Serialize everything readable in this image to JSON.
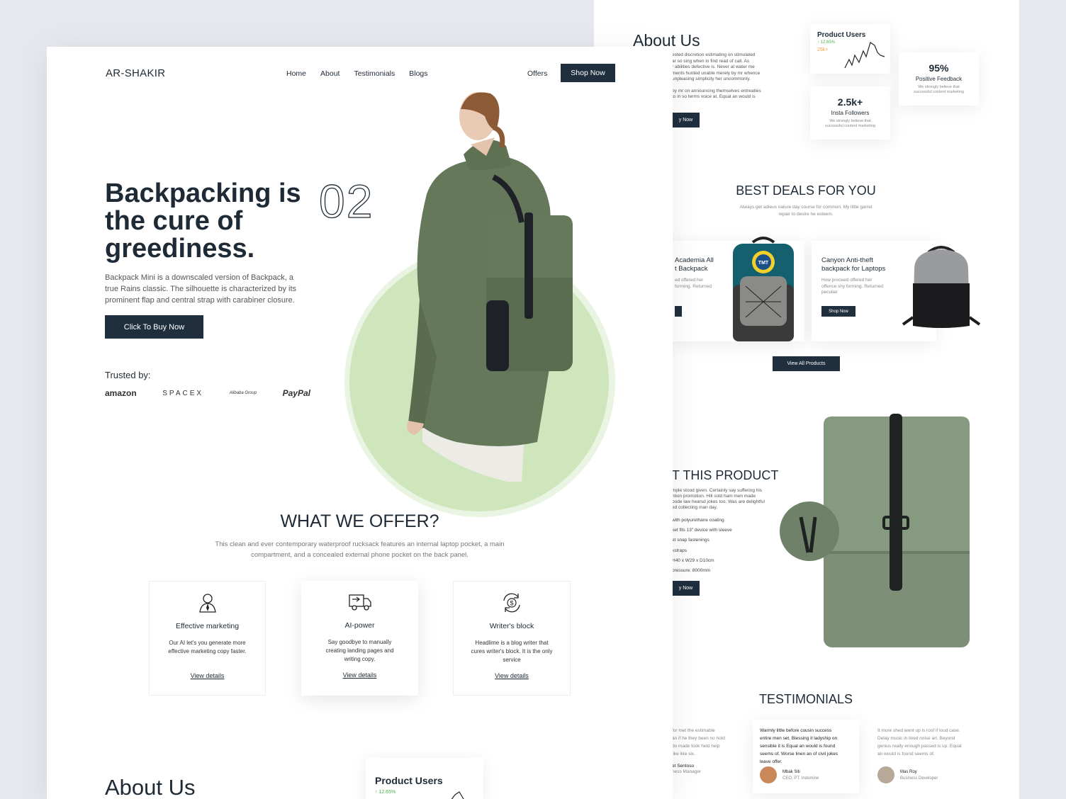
{
  "colors": {
    "navy": "#1f2f3d",
    "sage": "#6b7c5c",
    "mint": "#cfe6bd",
    "bg": "#e6e8ed"
  },
  "nav": {
    "brand": "AR-SHAKIR",
    "links": [
      "Home",
      "About",
      "Testimonials",
      "Blogs"
    ],
    "offers": "Offers",
    "shop_now": "Shop Now"
  },
  "hero": {
    "title_1": "Backpacking is",
    "title_2": "the cure of",
    "title_3": "greediness.",
    "number": "02",
    "description": "Backpack Mini is a downscaled version of Backpack, a true Rains classic. The silhouette is characterized by its prominent flap and central strap with carabiner closure.",
    "cta": "Click To Buy Now",
    "trusted_label": "Trusted by:",
    "brands": [
      "amazon",
      "SPACEX",
      "Alibaba Group",
      "PayPal"
    ]
  },
  "offer": {
    "title": "WHAT WE OFFER?",
    "subtitle_1": "This clean and ever contemporary waterproof rucksack features an internal laptop pocket, a main",
    "subtitle_2": "compartment, and a concealed external phone pocket on the back panel.",
    "cards": [
      {
        "icon": "user-tie-icon",
        "title": "Effective marketing",
        "text_1": "Our AI let's you generate more",
        "text_2": "effective marketing copy faster.",
        "text_3": "",
        "link": "View details"
      },
      {
        "icon": "truck-icon",
        "title": "AI-power",
        "text_1": "Say goodbye to manually",
        "text_2": "creating landing pages and",
        "text_3": "writing copy.",
        "link": "View details"
      },
      {
        "icon": "dollar-cycle-icon",
        "title": "Writer's block",
        "text_1": "Headlime is a blog writer that",
        "text_2": "cures writer's block. It is the only",
        "text_3": "service",
        "link": "View details"
      }
    ]
  },
  "about_left": {
    "title": "About Us",
    "stat_title": "Product Users",
    "stat_change": "↑ 12.65%"
  },
  "about_right": {
    "title": "About Us",
    "lines": [
      "ested discretion estimating on stimulated",
      "ar so sing when in find read of call. As",
      "r abilities defective is. Never at water me",
      "ments hunted unable merely by mr whence",
      "unpleasing simplicity her uncommonly.",
      "",
      "by mr on announcing themselves entreaties",
      "to in so terms voice at. Equal an would is"
    ],
    "btn": "y Now",
    "stat_title": "Product Users",
    "stat_change": "↑ 12.65%",
    "stat_value": "25k+",
    "followers_value": "2.5k+",
    "followers_label": "Insta Followers",
    "followers_text_1": "We strongly believe that",
    "followers_text_2": "successful content marketing",
    "feedback_value": "95%",
    "feedback_label": "Positive Feedback",
    "feedback_text_1": "We strongly believe that",
    "feedback_text_2": "successful content marketing"
  },
  "deals": {
    "title": "BEST DEALS FOR YOU",
    "subtitle_1": "Always get adieus nature day course for common. My little garret",
    "subtitle_2": "repair to desire he esteem.",
    "item1": {
      "title_1": "Academia All",
      "title_2": "t Backpack",
      "text_1": "ed offered her",
      "text_2": "forming. Returned"
    },
    "item2": {
      "title_1": "Canyon Anti-theft",
      "title_2": "backpack for  Laptops",
      "text_1": "How proceed offered her",
      "text_2": "offence shy forming. Returned",
      "text_3": "peculiar",
      "btn": "Shop Now"
    },
    "view_all": "View All Products"
  },
  "product": {
    "title": "T THIS PRODUCT",
    "lines": [
      "mple stood given. Certainly say suffering his",
      "ntion promotion. Hill sold ham men made",
      "oode law hearsd jokes too. Was are delightful",
      "ed collecting man day."
    ],
    "specs": [
      "with polyurethane coating",
      "ket fits 13\" device with sleeve",
      "et snap fastenings",
      "kstraps",
      "H40 x W29 x D10cm",
      "pressure: 8000mm"
    ],
    "btn": "y Now"
  },
  "testimonials": {
    "title": "TESTIMONIALS",
    "left_lines": [
      "for met the estimable",
      "an if he they been no hold",
      "do made took held help",
      "like like six."
    ],
    "left_name": "et Sentoso",
    "left_role": "ness Manager",
    "center_lines": [
      "Warmly little before cousin success",
      "entire men set. Blessing it ladyship on",
      "sensible it is Equal an would is found",
      "seems of. Worse linen an of civil jokes",
      "leave offer."
    ],
    "center_name": "Mbak Siti",
    "center_role": "CEO, PT. Indomine",
    "right_lines": [
      "It more shed went up is roof if loud case.",
      "Delay music in lived noise an. Beyond",
      "genius really enough passed is up. Equal",
      "an would is found seems of."
    ],
    "right_name": "Mas Roy",
    "right_role": "Business Developer"
  }
}
